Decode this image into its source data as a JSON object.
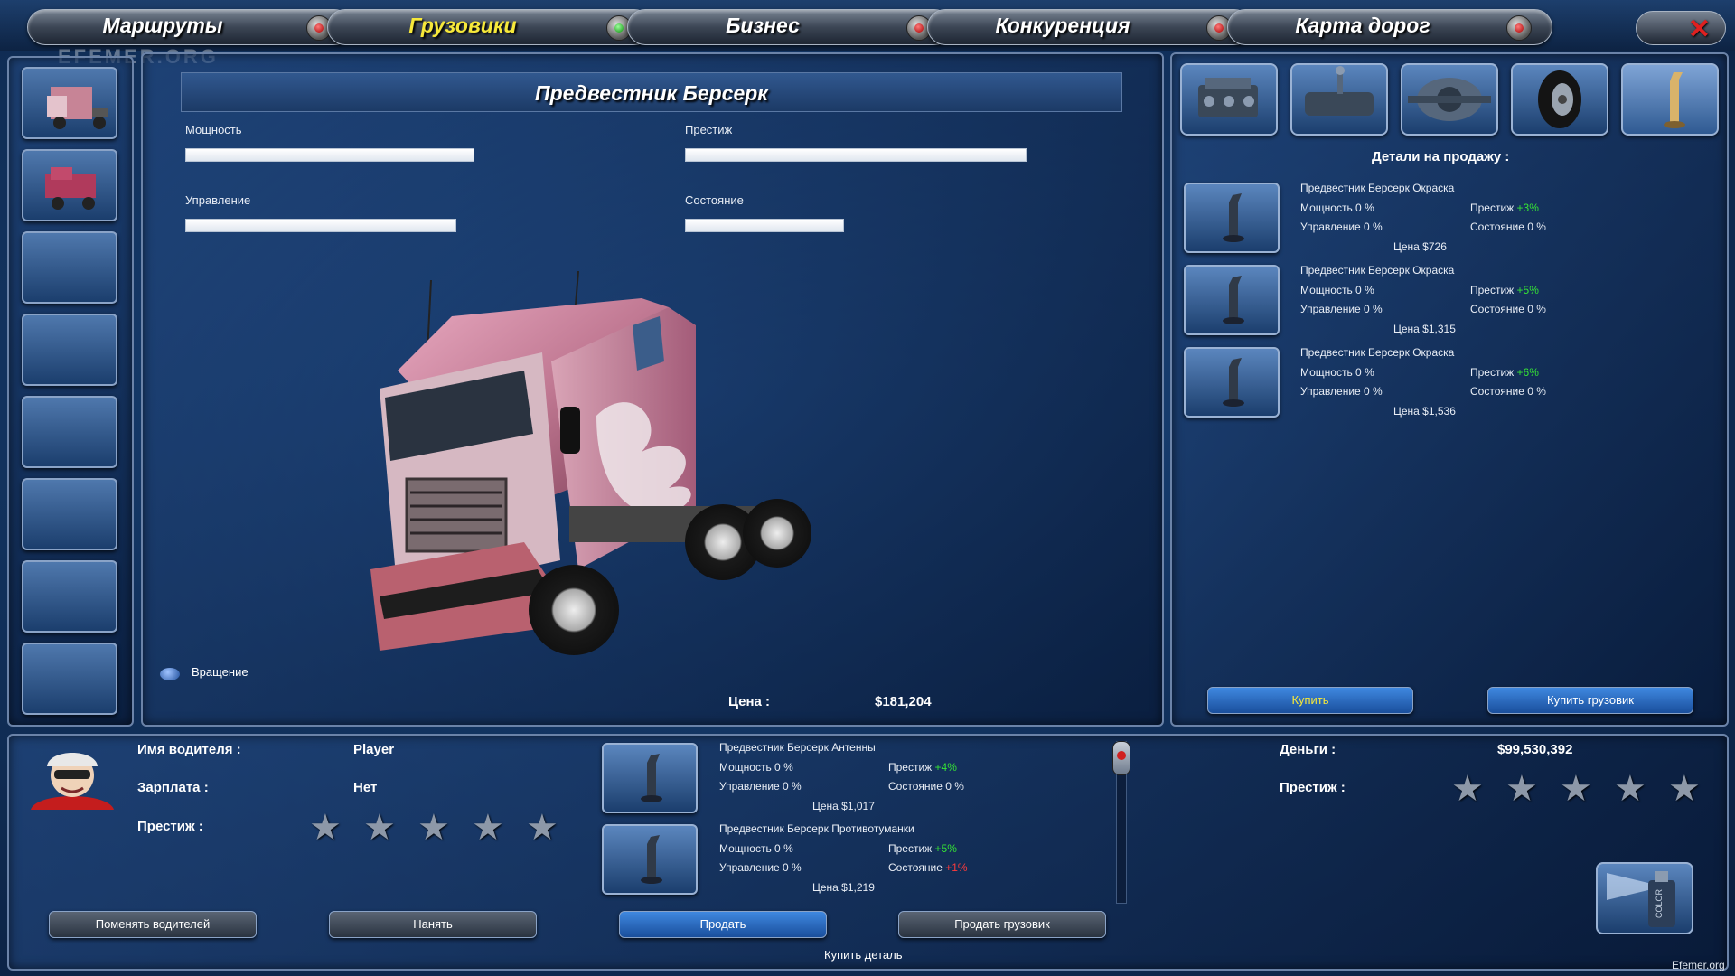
{
  "nav": {
    "tabs": [
      {
        "label": "Маршруты"
      },
      {
        "label": "Грузовики"
      },
      {
        "label": "Бизнес"
      },
      {
        "label": "Конкуренция"
      },
      {
        "label": "Карта дорог"
      }
    ],
    "active_index": 1,
    "close_icon": "close-icon"
  },
  "watermark": "EFEMER.ORG",
  "truck": {
    "name": "Предвестник Берсерк",
    "stats": {
      "power": {
        "label": "Мощность",
        "level": 0.82
      },
      "prestige": {
        "label": "Престиж",
        "level": 0.97
      },
      "handling": {
        "label": "Управление",
        "level": 0.77
      },
      "condition": {
        "label": "Состояние",
        "level": 0.45
      }
    },
    "rotate_label": "Вращение",
    "price_label": "Цена :",
    "price_value": "$181,204"
  },
  "shop": {
    "title": "Детали на продажу :",
    "categories": [
      "engine-icon",
      "transmission-icon",
      "chassis-icon",
      "tire-icon",
      "exhaust-icon"
    ],
    "active_category": 4,
    "items": [
      {
        "name": "Предвестник Берсерк Окраска",
        "power": "Мощность 0 %",
        "prestige_label": "Престиж",
        "prestige_value": "+3%",
        "handling": "Управление 0 %",
        "condition": "Состояние 0 %",
        "price": "Цена $726"
      },
      {
        "name": "Предвестник Берсерк Окраска",
        "power": "Мощность 0 %",
        "prestige_label": "Престиж",
        "prestige_value": "+5%",
        "handling": "Управление 0 %",
        "condition": "Состояние 0 %",
        "price": "Цена $1,315"
      },
      {
        "name": "Предвестник Берсерк Окраска",
        "power": "Мощность 0 %",
        "prestige_label": "Престиж",
        "prestige_value": "+6%",
        "handling": "Управление 0 %",
        "condition": "Состояние 0 %",
        "price": "Цена $1,536"
      }
    ],
    "buy_label": "Купить",
    "buy_truck_label": "Купить грузовик"
  },
  "driver": {
    "name_label": "Имя водителя :",
    "name_value": "Player",
    "salary_label": "Зарплата :",
    "salary_value": "Нет",
    "prestige_label": "Престиж :",
    "prestige_stars": 5,
    "change_label": "Поменять водителей",
    "hire_label": "Нанять"
  },
  "installed": {
    "items": [
      {
        "name": "Предвестник Берсерк Антенны",
        "power": "Мощность 0 %",
        "prestige_label": "Престиж",
        "prestige_value": "+4%",
        "handling": "Управление 0 %",
        "condition": "Состояние 0 %",
        "price": "Цена $1,017"
      },
      {
        "name": "Предвестник Берсерк Противотуманки",
        "power": "Мощность 0 %",
        "prestige_label": "Престиж",
        "prestige_value": "+5%",
        "handling": "Управление 0 %",
        "condition_label": "Состояние",
        "condition_value": "+1%",
        "price": "Цена $1,219"
      }
    ],
    "sell_label": "Продать",
    "sell_truck_label": "Продать грузовик",
    "buy_part_label": "Купить деталь"
  },
  "company": {
    "money_label": "Деньги :",
    "money_value": "$99,530,392",
    "prestige_label": "Престиж :",
    "prestige_stars": 5
  },
  "paint_can_text": "COLOR",
  "site_tag": "Efemer.org",
  "colors": {
    "positive": "#35e335",
    "negative": "#ff3b3b",
    "active_tab": "#f6e83a"
  }
}
